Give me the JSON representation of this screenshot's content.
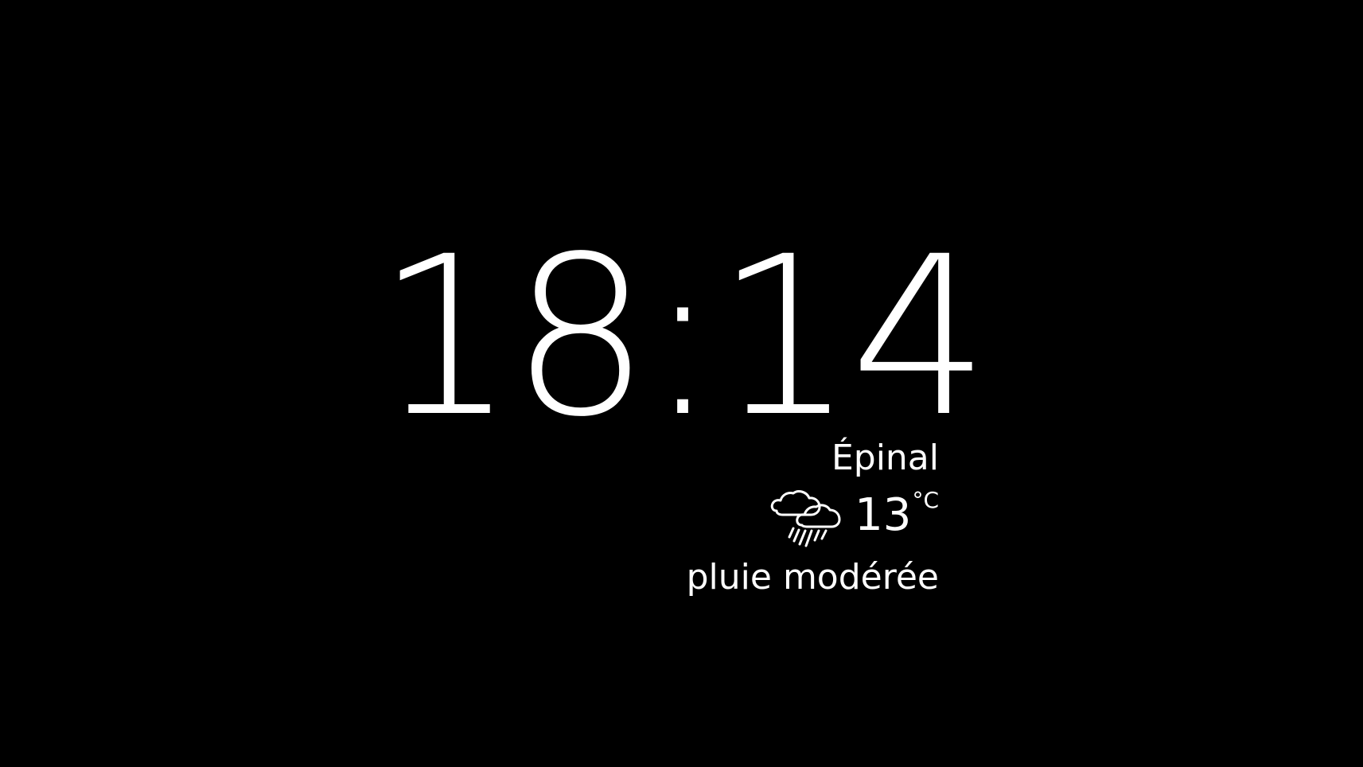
{
  "clock": {
    "time": "18:14"
  },
  "weather": {
    "city": "Épinal",
    "temperature": "13",
    "unit": "°C",
    "condition": "pluie modérée",
    "icon": "cloud-rain-icon"
  },
  "colors": {
    "background": "#000000",
    "foreground": "#ffffff"
  }
}
